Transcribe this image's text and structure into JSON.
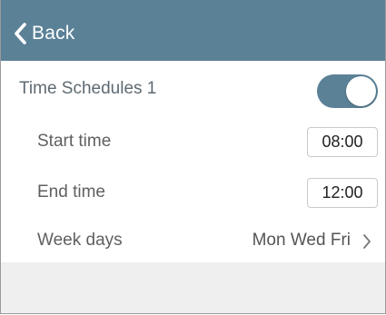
{
  "header": {
    "back_label": "Back",
    "background_color": "#5b8197"
  },
  "schedule": {
    "title": "Time Schedules 1",
    "enabled": true,
    "toggle_color": "#5b8197"
  },
  "start": {
    "label": "Start time",
    "value": "08:00"
  },
  "end": {
    "label": "End time",
    "value": "12:00"
  },
  "week": {
    "label": "Week days",
    "value": "Mon Wed Fri"
  },
  "icons": {
    "back": "chevron-left-icon",
    "week_disclosure": "chevron-right-icon"
  }
}
